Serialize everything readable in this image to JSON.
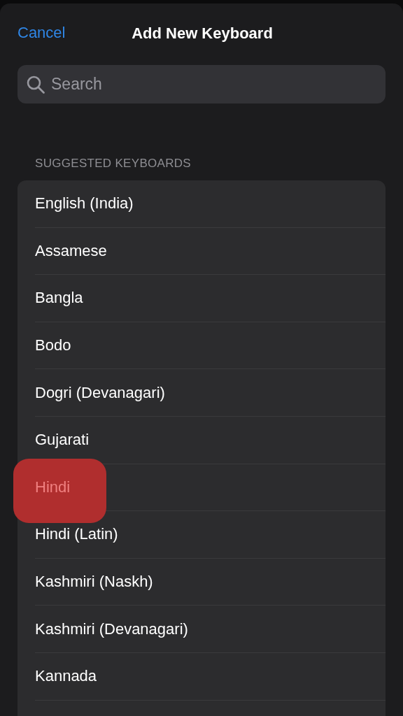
{
  "nav": {
    "cancel": "Cancel",
    "title": "Add New Keyboard"
  },
  "search": {
    "placeholder": "Search"
  },
  "section": {
    "header": "SUGGESTED KEYBOARDS",
    "items": [
      {
        "label": "English (India)",
        "highlighted": false
      },
      {
        "label": "Assamese",
        "highlighted": false
      },
      {
        "label": "Bangla",
        "highlighted": false
      },
      {
        "label": "Bodo",
        "highlighted": false
      },
      {
        "label": "Dogri (Devanagari)",
        "highlighted": false
      },
      {
        "label": "Gujarati",
        "highlighted": false
      },
      {
        "label": "Hindi",
        "highlighted": true
      },
      {
        "label": "Hindi (Latin)",
        "highlighted": false
      },
      {
        "label": "Kashmiri (Naskh)",
        "highlighted": false
      },
      {
        "label": "Kashmiri (Devanagari)",
        "highlighted": false
      },
      {
        "label": "Kannada",
        "highlighted": false
      }
    ]
  }
}
